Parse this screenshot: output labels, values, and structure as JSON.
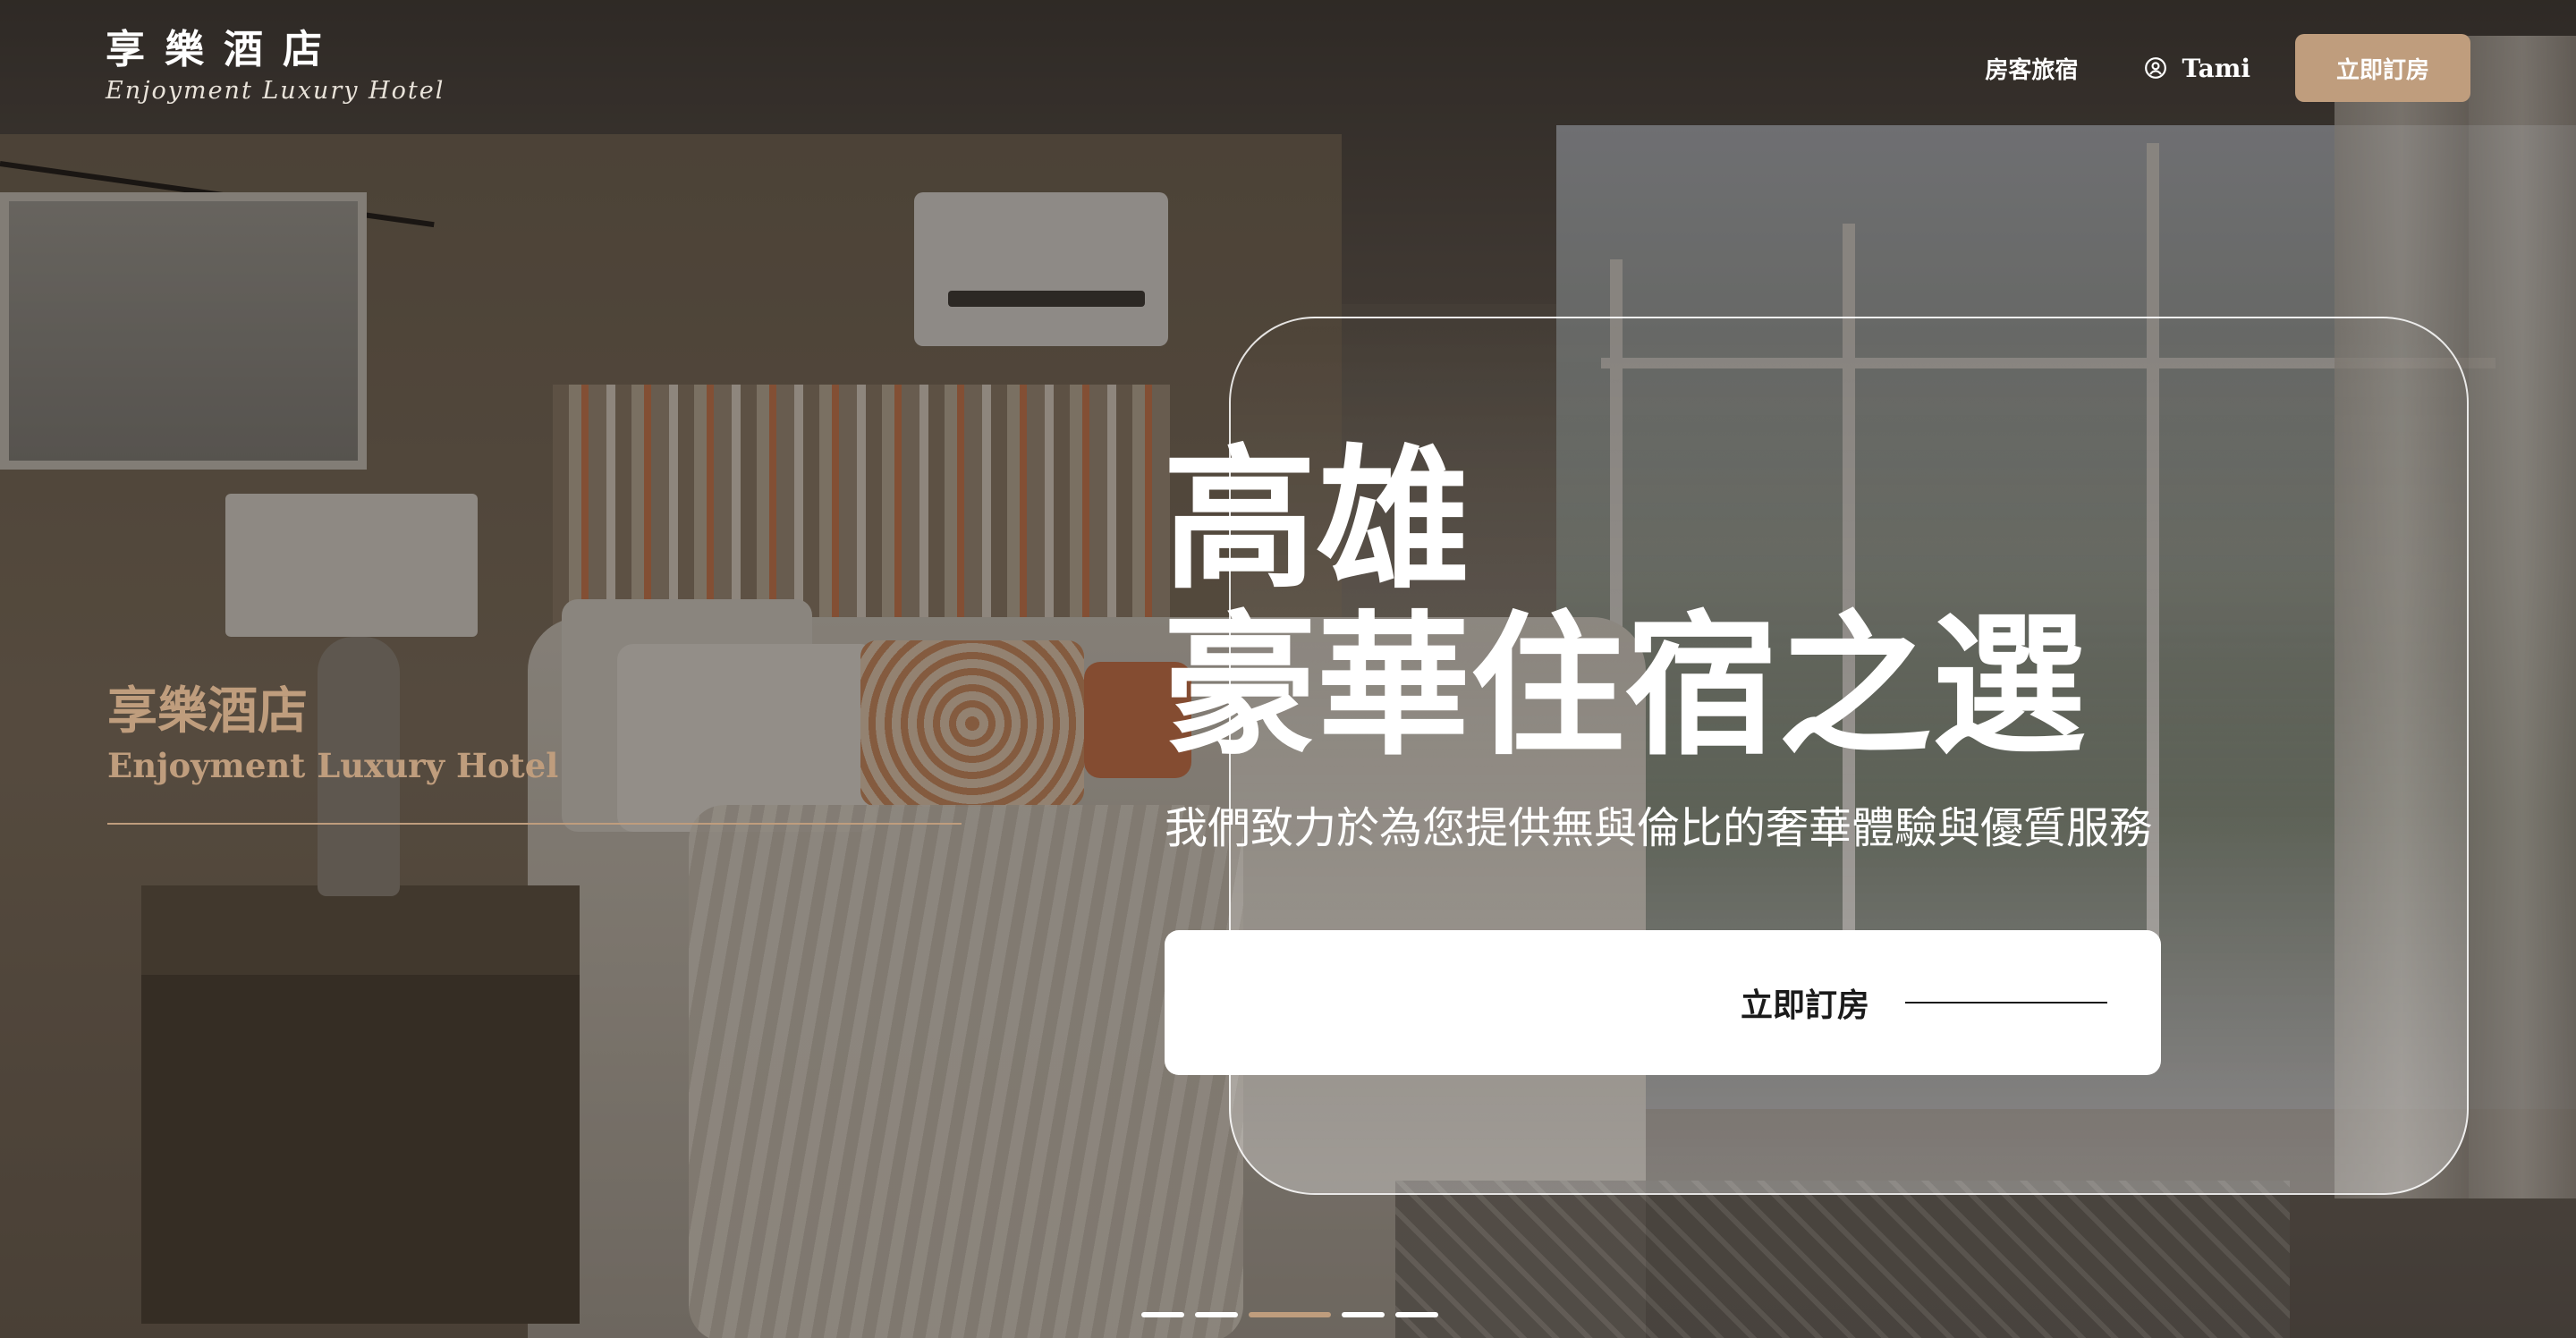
{
  "brand": {
    "name_zh": "享樂酒店",
    "name_en": "Enjoyment Luxury Hotel"
  },
  "nav": {
    "rooms_label": "房客旅宿",
    "user_name": "Tami",
    "book_button": "立即訂房",
    "user_icon": "user-circle-icon"
  },
  "hero": {
    "side_title_zh": "享樂酒店",
    "side_title_en": "Enjoyment Luxury Hotel",
    "headline_line1": "高雄",
    "headline_line2": "豪華住宿之選",
    "subtitle": "我們致力於為您提供無與倫比的奢華體驗與優質服務",
    "cta_label": "立即訂房"
  },
  "slider": {
    "count": 5,
    "active_index": 2
  },
  "colors": {
    "accent": "#bf9d7d",
    "white": "#ffffff",
    "cta_text": "#1a1a1a"
  }
}
